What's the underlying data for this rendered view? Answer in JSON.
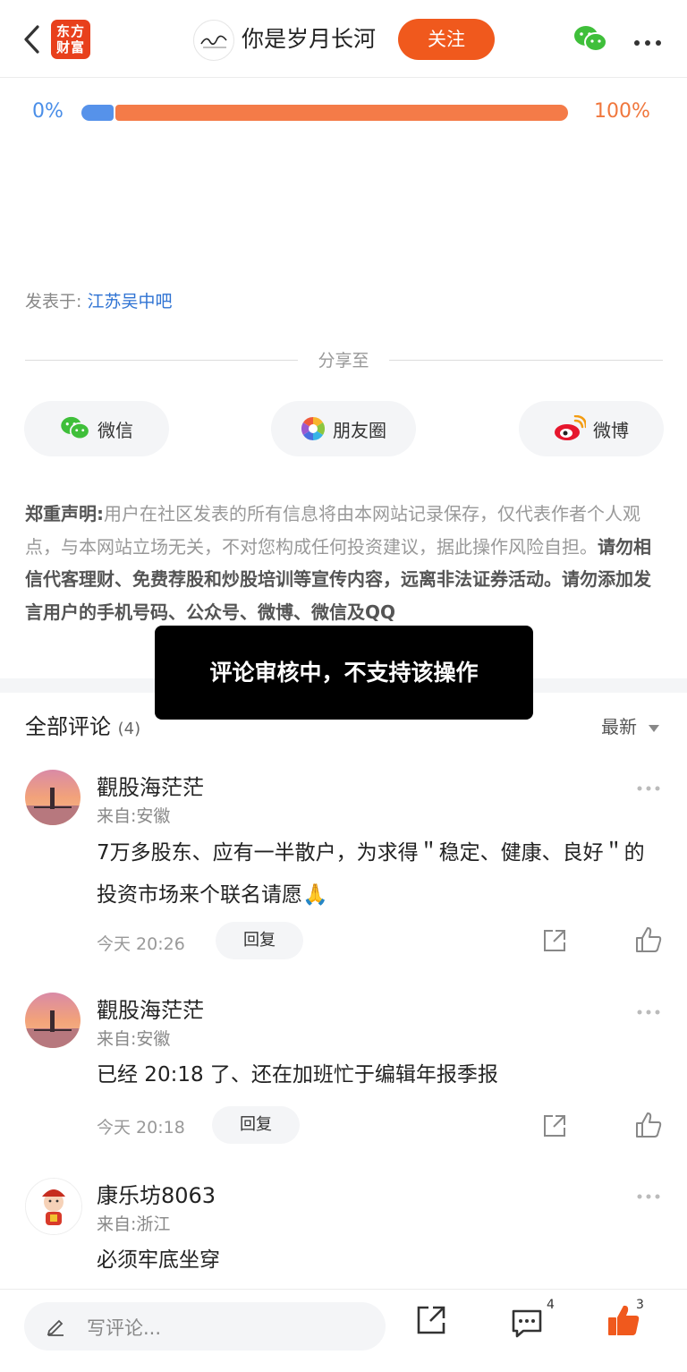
{
  "header": {
    "logo_text": "东方财富",
    "author_name": "你是岁月长河",
    "follow_label": "关注"
  },
  "progress": {
    "left_label": "0%",
    "right_label": "100%",
    "value": 0.95
  },
  "post": {
    "posted_prefix": "发表于:",
    "posted_bar": "江苏吴中吧"
  },
  "share": {
    "title": "分享至",
    "wechat": "微信",
    "moments": "朋友圈",
    "weibo": "微博"
  },
  "disclaimer": {
    "label": "郑重声明:",
    "text1": "用户在社区发表的所有信息将由本网站记录保存，仅代表作者个人观点，与本网站立场无关，不对您构成任何投资建议，据此操作风险自担。",
    "text2": "请勿相信代客理财、免费荐股和炒股培训等宣传内容，远离非法证券活动。请勿添加发言用户的手机号码、公众号、微博、微信及QQ"
  },
  "toast": "评论审核中，不支持该操作",
  "comments_section": {
    "title": "全部评论",
    "count": "(4)",
    "sort": "最新"
  },
  "comments": [
    {
      "name": "觀股海茫茫",
      "location": "来自:安徽",
      "text": "7万多股东、应有一半散户，为求得＂稳定、健康、良好＂的投资市场来个联名请愿🙏",
      "time": "今天 20:26",
      "reply": "回复"
    },
    {
      "name": "觀股海茫茫",
      "location": "来自:安徽",
      "text": "已经 20:18 了、还在加班忙于编辑年报季报",
      "time": "今天 20:18",
      "reply": "回复"
    },
    {
      "name": "康乐坊8063",
      "location": "来自:浙江",
      "text": "必须牢底坐穿"
    }
  ],
  "bottom": {
    "placeholder": "写评论...",
    "comment_count": "4",
    "like_count": "3"
  }
}
